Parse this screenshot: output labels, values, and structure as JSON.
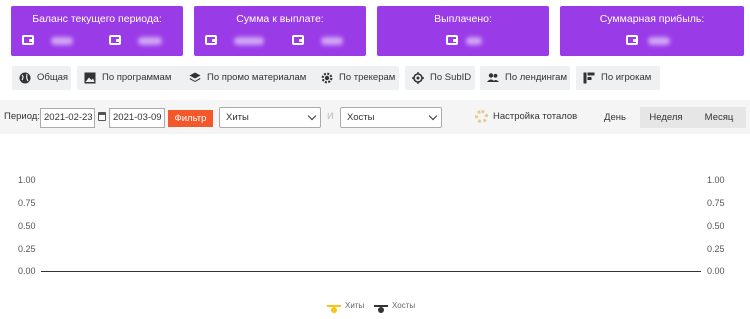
{
  "cards": [
    {
      "title": "Баланс текущего периода:",
      "values": [
        "••••",
        "••••"
      ]
    },
    {
      "title": "Сумма к выплате:",
      "values": [
        "••••••",
        "••••"
      ]
    },
    {
      "title": "Выплачено:",
      "values": [
        "••••"
      ]
    },
    {
      "title": "Суммарная прибыль:",
      "values": [
        "••••"
      ]
    }
  ],
  "tabs": [
    {
      "label": "Общая",
      "icon": "globe-icon"
    },
    {
      "label": "По программам",
      "icon": "image-icon"
    },
    {
      "label": "По промо материалам",
      "icon": "layers-icon"
    },
    {
      "label": "По трекерам",
      "icon": "gear-icon"
    },
    {
      "label": "По SubID",
      "icon": "target-icon"
    },
    {
      "label": "По лендингам",
      "icon": "users-icon"
    },
    {
      "label": "По игрокам",
      "icon": "blocks-icon"
    }
  ],
  "filter": {
    "period_label": "Период:",
    "date_from": "2021-02-23",
    "date_to": "2021-03-09",
    "button": "Фильтр",
    "metric1": "Хиты",
    "conjunction": "И",
    "metric2": "Хосты",
    "totals_settings": "Настройка тоталов",
    "granularity": [
      "День",
      "Неделя",
      "Месяц"
    ],
    "selected_granularity": "Неделя"
  },
  "colors": {
    "card": "#9a3be8",
    "filter_button": "#f4572a",
    "hits": "#f5c518",
    "hosts": "#333333"
  },
  "chart_data": {
    "type": "line",
    "x": [],
    "series": [
      {
        "name": "Хиты",
        "values": []
      },
      {
        "name": "Хосты",
        "values": []
      }
    ],
    "y_ticks_left": [
      "1.00",
      "0.75",
      "0.50",
      "0.25",
      "0.00"
    ],
    "y_ticks_right": [
      "1.00",
      "0.75",
      "0.50",
      "0.25",
      "0.00"
    ],
    "ylim": [
      0,
      1
    ],
    "legend": "bottom-center",
    "grid": false
  }
}
